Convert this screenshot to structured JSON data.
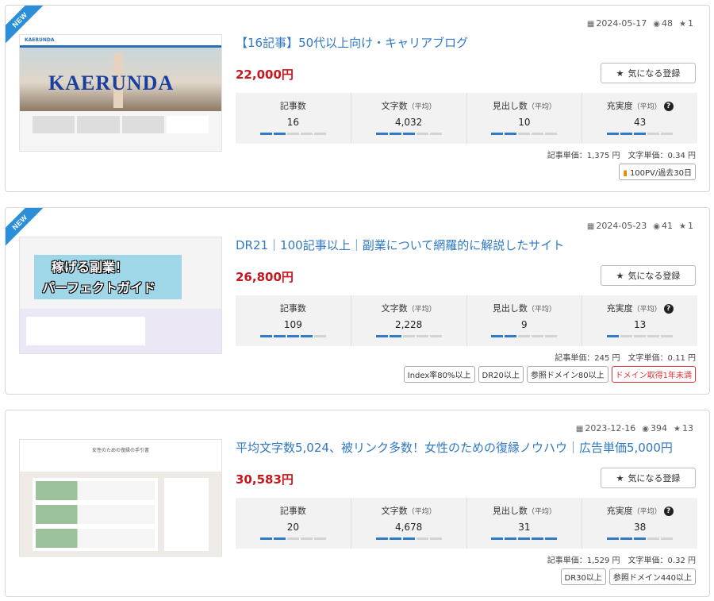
{
  "colors": {
    "accent": "#2a8fd8",
    "title_link": "#2f78c4",
    "price": "#c8161d",
    "bar_on": "#2a7bc8",
    "bar_off": "#d3d3d3",
    "warning_tag": "#d33333"
  },
  "common": {
    "fav_label": "気になる登録",
    "stat_labels": {
      "articles": "記事数",
      "chars": "文字数",
      "chars_note": "（平均）",
      "headings": "見出し数",
      "headings_note": "（平均）",
      "completeness": "充実度",
      "completeness_note": "（平均）"
    },
    "icons": {
      "date": "calendar-icon",
      "views": "eye-icon",
      "stars": "star-icon",
      "help": "question-circle-icon",
      "chart": "bar-chart-icon"
    }
  },
  "listings": [
    {
      "badge": "NEW",
      "date": "2024-05-17",
      "views": "48",
      "stars": "1",
      "title": "【16記事】50代以上向け・キャリアブログ",
      "price": "22,000円",
      "stats": {
        "articles": "16",
        "chars": "4,032",
        "headings": "10",
        "completeness": "43"
      },
      "levels": {
        "articles": 0.4,
        "chars": 0.6,
        "headings": 0.4,
        "completeness": 0.6
      },
      "unit_prices": "記事単価：1,375 円　文字単価：0.34 円",
      "tags": [
        "100PV/過去30日"
      ],
      "thumb_text": {
        "site": "KAERUNDA",
        "hero": "KAERUNDA"
      }
    },
    {
      "badge": "NEW",
      "date": "2024-05-23",
      "views": "41",
      "stars": "1",
      "title": "DR21｜100記事以上｜副業について網羅的に解説したサイト",
      "price": "26,800円",
      "stats": {
        "articles": "109",
        "chars": "2,228",
        "headings": "9",
        "completeness": "13"
      },
      "levels": {
        "articles": 0.8,
        "chars": 0.4,
        "headings": 0.4,
        "completeness": 0.2
      },
      "unit_prices": "記事単価：245 円　文字単価：0.11 円",
      "tags": [
        "Index率80%以上",
        "DR20以上",
        "参照ドメイン80以上",
        "ドメイン取得1年未満"
      ],
      "thumb_text": {
        "line1": "稼げる副業！",
        "line2": "パーフェクトガイド"
      }
    },
    {
      "badge": "",
      "date": "2023-12-16",
      "views": "394",
      "stars": "13",
      "title": "平均文字数5,024、被リンク多数！女性のための復縁ノウハウ｜広告単価5,000円",
      "price": "30,583円",
      "stats": {
        "articles": "20",
        "chars": "4,678",
        "headings": "31",
        "completeness": "38"
      },
      "levels": {
        "articles": 0.4,
        "chars": 0.6,
        "headings": 1.0,
        "completeness": 0.6
      },
      "unit_prices": "記事単価：1,529 円　文字単価：0.32 円",
      "tags": [
        "DR30以上",
        "参照ドメイン440以上"
      ],
      "thumb_text": {
        "site": "女性のための復縁の手引書"
      }
    }
  ]
}
